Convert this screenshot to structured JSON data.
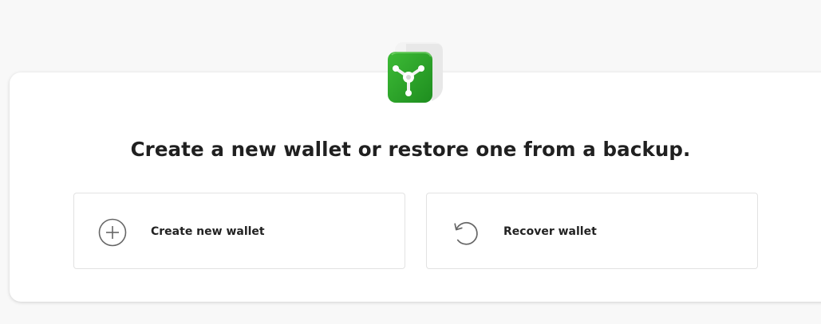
{
  "theme": {
    "background": "#f8f8f8",
    "card": "#ffffff",
    "brand_green": "#2ea82b"
  },
  "logo": {
    "icon": "wallet-safe-logo-icon"
  },
  "main": {
    "headline": "Create a new wallet or restore one from a backup."
  },
  "options": {
    "create": {
      "label": "Create new wallet",
      "icon": "plus-circle-icon"
    },
    "recover": {
      "label": "Recover wallet",
      "icon": "restore-icon"
    }
  }
}
